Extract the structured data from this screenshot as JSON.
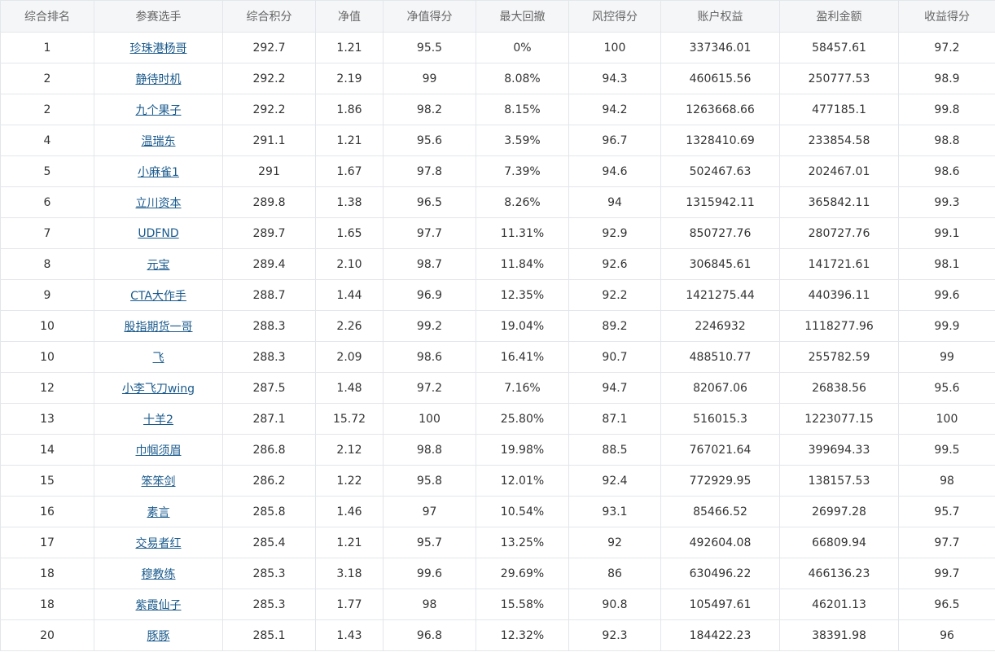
{
  "headers": [
    "综合排名",
    "参赛选手",
    "综合积分",
    "净值",
    "净值得分",
    "最大回撤",
    "风控得分",
    "账户权益",
    "盈利金额",
    "收益得分"
  ],
  "rows": [
    [
      "1",
      "珍珠港杨哥",
      "292.7",
      "1.21",
      "95.5",
      "0%",
      "100",
      "337346.01",
      "58457.61",
      "97.2"
    ],
    [
      "2",
      "静待时机",
      "292.2",
      "2.19",
      "99",
      "8.08%",
      "94.3",
      "460615.56",
      "250777.53",
      "98.9"
    ],
    [
      "2",
      "九个果子",
      "292.2",
      "1.86",
      "98.2",
      "8.15%",
      "94.2",
      "1263668.66",
      "477185.1",
      "99.8"
    ],
    [
      "4",
      "温瑞东",
      "291.1",
      "1.21",
      "95.6",
      "3.59%",
      "96.7",
      "1328410.69",
      "233854.58",
      "98.8"
    ],
    [
      "5",
      "小麻雀1",
      "291",
      "1.67",
      "97.8",
      "7.39%",
      "94.6",
      "502467.63",
      "202467.01",
      "98.6"
    ],
    [
      "6",
      "立川资本",
      "289.8",
      "1.38",
      "96.5",
      "8.26%",
      "94",
      "1315942.11",
      "365842.11",
      "99.3"
    ],
    [
      "7",
      "UDFND",
      "289.7",
      "1.65",
      "97.7",
      "11.31%",
      "92.9",
      "850727.76",
      "280727.76",
      "99.1"
    ],
    [
      "8",
      "元宝",
      "289.4",
      "2.10",
      "98.7",
      "11.84%",
      "92.6",
      "306845.61",
      "141721.61",
      "98.1"
    ],
    [
      "9",
      "CTA大作手",
      "288.7",
      "1.44",
      "96.9",
      "12.35%",
      "92.2",
      "1421275.44",
      "440396.11",
      "99.6"
    ],
    [
      "10",
      "股指期货一哥",
      "288.3",
      "2.26",
      "99.2",
      "19.04%",
      "89.2",
      "2246932",
      "1118277.96",
      "99.9"
    ],
    [
      "10",
      "飞",
      "288.3",
      "2.09",
      "98.6",
      "16.41%",
      "90.7",
      "488510.77",
      "255782.59",
      "99"
    ],
    [
      "12",
      "小李飞刀wing",
      "287.5",
      "1.48",
      "97.2",
      "7.16%",
      "94.7",
      "82067.06",
      "26838.56",
      "95.6"
    ],
    [
      "13",
      "十羊2",
      "287.1",
      "15.72",
      "100",
      "25.80%",
      "87.1",
      "516015.3",
      "1223077.15",
      "100"
    ],
    [
      "14",
      "巾帼须眉",
      "286.8",
      "2.12",
      "98.8",
      "19.98%",
      "88.5",
      "767021.64",
      "399694.33",
      "99.5"
    ],
    [
      "15",
      "笨笨剑",
      "286.2",
      "1.22",
      "95.8",
      "12.01%",
      "92.4",
      "772929.95",
      "138157.53",
      "98"
    ],
    [
      "16",
      "素言",
      "285.8",
      "1.46",
      "97",
      "10.54%",
      "93.1",
      "85466.52",
      "26997.28",
      "95.7"
    ],
    [
      "17",
      "交易者红",
      "285.4",
      "1.21",
      "95.7",
      "13.25%",
      "92",
      "492604.08",
      "66809.94",
      "97.7"
    ],
    [
      "18",
      "穆教练",
      "285.3",
      "3.18",
      "99.6",
      "29.69%",
      "86",
      "630496.22",
      "466136.23",
      "99.7"
    ],
    [
      "18",
      "紫霞仙子",
      "285.3",
      "1.77",
      "98",
      "15.58%",
      "90.8",
      "105497.61",
      "46201.13",
      "96.5"
    ],
    [
      "20",
      "豚豚",
      "285.1",
      "1.43",
      "96.8",
      "12.32%",
      "92.3",
      "184422.23",
      "38391.98",
      "96"
    ]
  ],
  "colors": {
    "border": "#e3e6ea",
    "header_bg": "#f5f6f8",
    "link": "#1a5a8c",
    "text": "#333333"
  }
}
